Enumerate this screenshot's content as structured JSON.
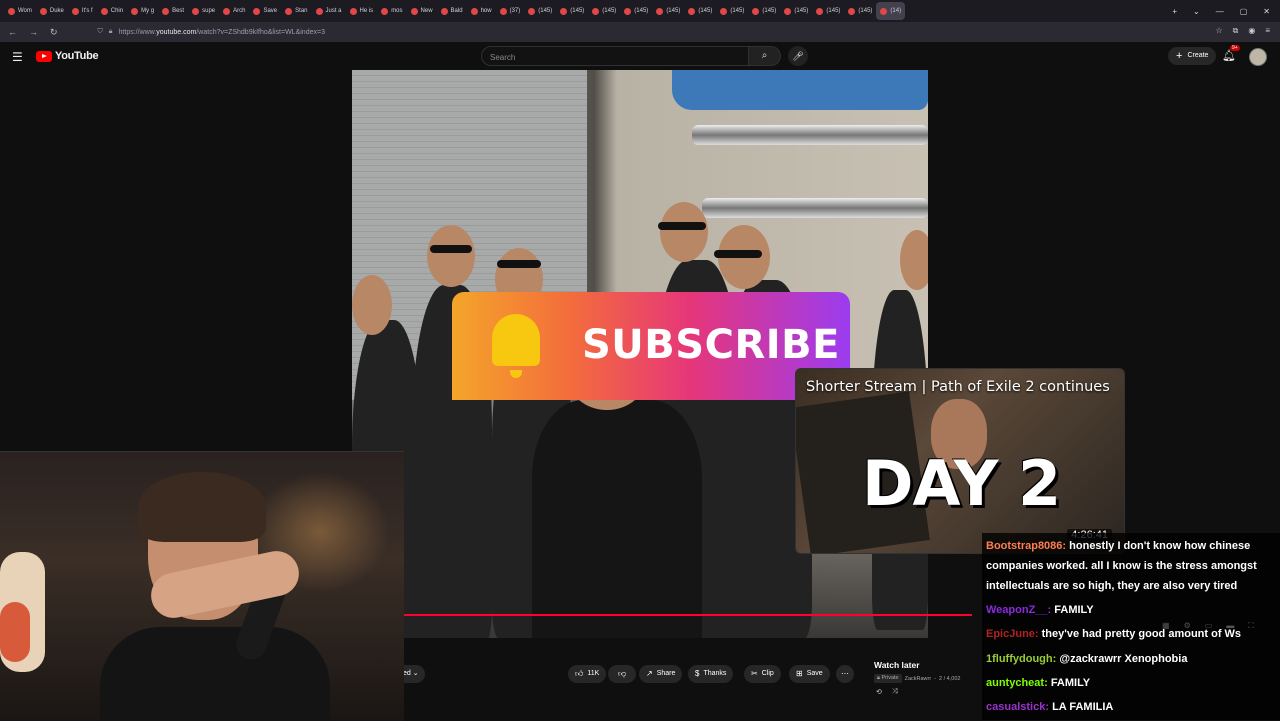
{
  "browser": {
    "tabs": [
      "Wom",
      "Duke",
      "It's f",
      "Chin",
      "My g",
      "Best",
      "supe",
      "Arch",
      "Save",
      "Stan",
      "Just a",
      "He is",
      "mos",
      "New",
      "Bald",
      "how",
      "(37)",
      "(145)",
      "(145)",
      "(145)",
      "(145)",
      "(145)",
      "(145)",
      "(145)",
      "(145)",
      "(145)",
      "(145)",
      "(145)",
      "(14)"
    ],
    "url_prefix": "https://www.",
    "url_host": "youtube.com",
    "url_rest": "/watch?v=ZShdb9kIfho&list=WL&index=3"
  },
  "youtube": {
    "logo_text": "YouTube",
    "search_placeholder": "Search",
    "create_label": "Create",
    "notification_count": "9+"
  },
  "video": {
    "subscribe_text": "SUBSCRIBE"
  },
  "actions": {
    "subscribed_partial": "ed",
    "like_count": "11K",
    "share": "Share",
    "thanks": "Thanks",
    "clip": "Clip",
    "save": "Save"
  },
  "watch_later": {
    "title": "Watch later",
    "privacy": "Private",
    "owner": "ZackRawrr",
    "position": "2 / 4,002"
  },
  "stream_overlay": {
    "title": "Shorter Stream | Path of Exile 2 continues",
    "big_text": "DAY 2",
    "duration": "4:26:41"
  },
  "chat": [
    {
      "user": "Bootstrap8086",
      "color": "#ff7f50",
      "message": "honestly I don't know how chinese"
    },
    {
      "user": "",
      "color": "#ffffff",
      "message": "companies worked. all I know is the stress amongst"
    },
    {
      "user": "",
      "color": "#ffffff",
      "message": "intellectuals are so high, they are also very tired"
    },
    {
      "user": "WeaponZ__",
      "color": "#8a2be2",
      "message": "FAMILY"
    },
    {
      "user": "EpicJune",
      "color": "#b22222",
      "message": "they've had pretty good amount of Ws"
    },
    {
      "user": "1fluffydough",
      "color": "#9acd32",
      "message": "@zackrawrr Xenophobia"
    },
    {
      "user": "auntycheat",
      "color": "#7fff00",
      "message": "FAMILY"
    },
    {
      "user": "casualstick",
      "color": "#9932cc",
      "message": "LA FAMILIA"
    }
  ],
  "colors": {
    "yt_red": "#ff0000",
    "progress": "#ff0033",
    "background": "#0f0f0f"
  }
}
